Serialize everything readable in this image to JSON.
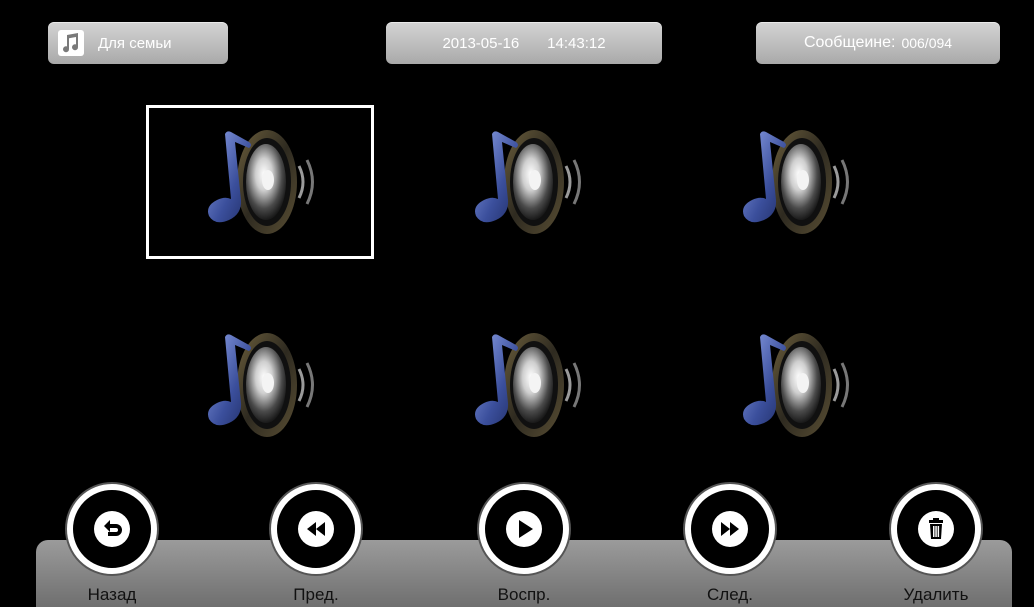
{
  "header": {
    "folder_name": "Для семьи",
    "date": "2013-05-16",
    "time": "14:43:12",
    "message_label": "Сообщеине:",
    "message_count": "006/094"
  },
  "grid": {
    "items": [
      {
        "icon": "music-speaker-icon",
        "selected": true
      },
      {
        "icon": "music-speaker-icon",
        "selected": false
      },
      {
        "icon": "music-speaker-icon",
        "selected": false
      },
      {
        "icon": "music-speaker-icon",
        "selected": false
      },
      {
        "icon": "music-speaker-icon",
        "selected": false
      },
      {
        "icon": "music-speaker-icon",
        "selected": false
      }
    ]
  },
  "toolbar": {
    "back_label": "Назад",
    "prev_label": "Пред.",
    "play_label": "Воспр.",
    "next_label": "След.",
    "delete_label": "Удалить"
  },
  "colors": {
    "background": "#000000",
    "pill": "#b8b8b8",
    "toolbar": "#8a8a8a",
    "note": "#3b4f9c"
  }
}
